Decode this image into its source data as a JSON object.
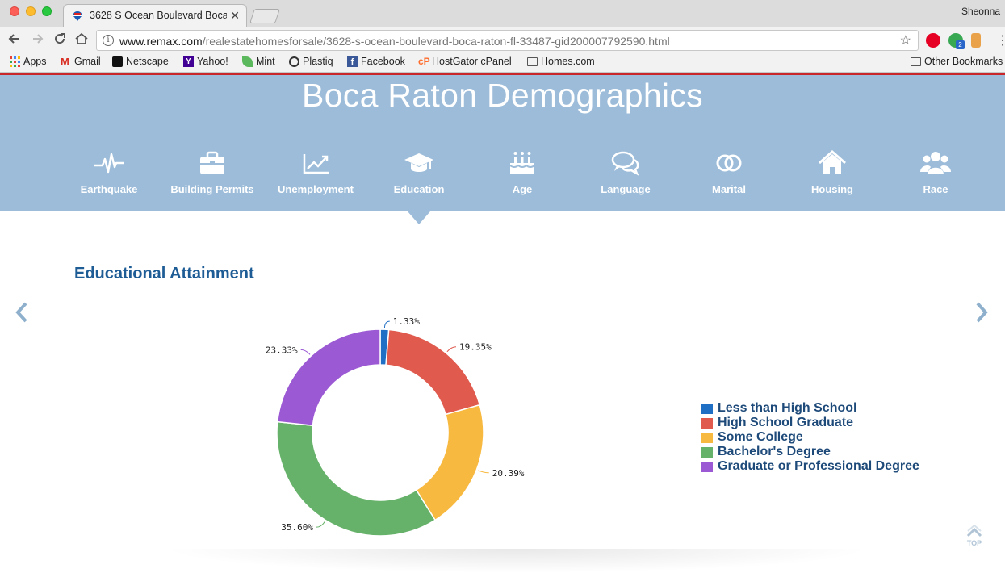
{
  "browser": {
    "tab_title": "3628 S Ocean Boulevard Boca",
    "profile_name": "Sheonna",
    "url_domain": "www.remax.com",
    "url_path": "/realestatehomesforsale/3628-s-ocean-boulevard-boca-raton-fl-33487-gid200007792590.html",
    "extension_badge": "2",
    "bookmarks": [
      "Apps",
      "Gmail",
      "Netscape",
      "Yahoo!",
      "Mint",
      "Plastiq",
      "Facebook",
      "HostGator cPanel",
      "Homes.com"
    ],
    "other_bookmarks": "Other Bookmarks"
  },
  "page": {
    "title": "Boca Raton Demographics",
    "nav": [
      {
        "label": "Earthquake",
        "icon": "earthquake-icon"
      },
      {
        "label": "Building Permits",
        "icon": "briefcase-icon"
      },
      {
        "label": "Unemployment",
        "icon": "trend-chart-icon"
      },
      {
        "label": "Education",
        "icon": "graduation-cap-icon"
      },
      {
        "label": "Age",
        "icon": "birthday-cake-icon"
      },
      {
        "label": "Language",
        "icon": "speech-bubbles-icon"
      },
      {
        "label": "Marital",
        "icon": "rings-icon"
      },
      {
        "label": "Housing",
        "icon": "house-icon"
      },
      {
        "label": "Race",
        "icon": "people-icon"
      }
    ],
    "active_nav": "Education",
    "section_title": "Educational Attainment",
    "top_label": "TOP"
  },
  "chart_data": {
    "type": "pie",
    "variant": "donut",
    "categories": [
      "Less than High School",
      "High School Graduate",
      "Some College",
      "Bachelor's Degree",
      "Graduate or Professional Degree"
    ],
    "values": [
      1.33,
      19.35,
      20.39,
      35.6,
      23.33
    ],
    "labels": [
      "1.33%",
      "19.35%",
      "20.39%",
      "35.60%",
      "23.33%"
    ],
    "colors": [
      "#1f6fc5",
      "#e05a4e",
      "#f8b940",
      "#67b26a",
      "#9b59d4"
    ],
    "legend_position": "right"
  }
}
